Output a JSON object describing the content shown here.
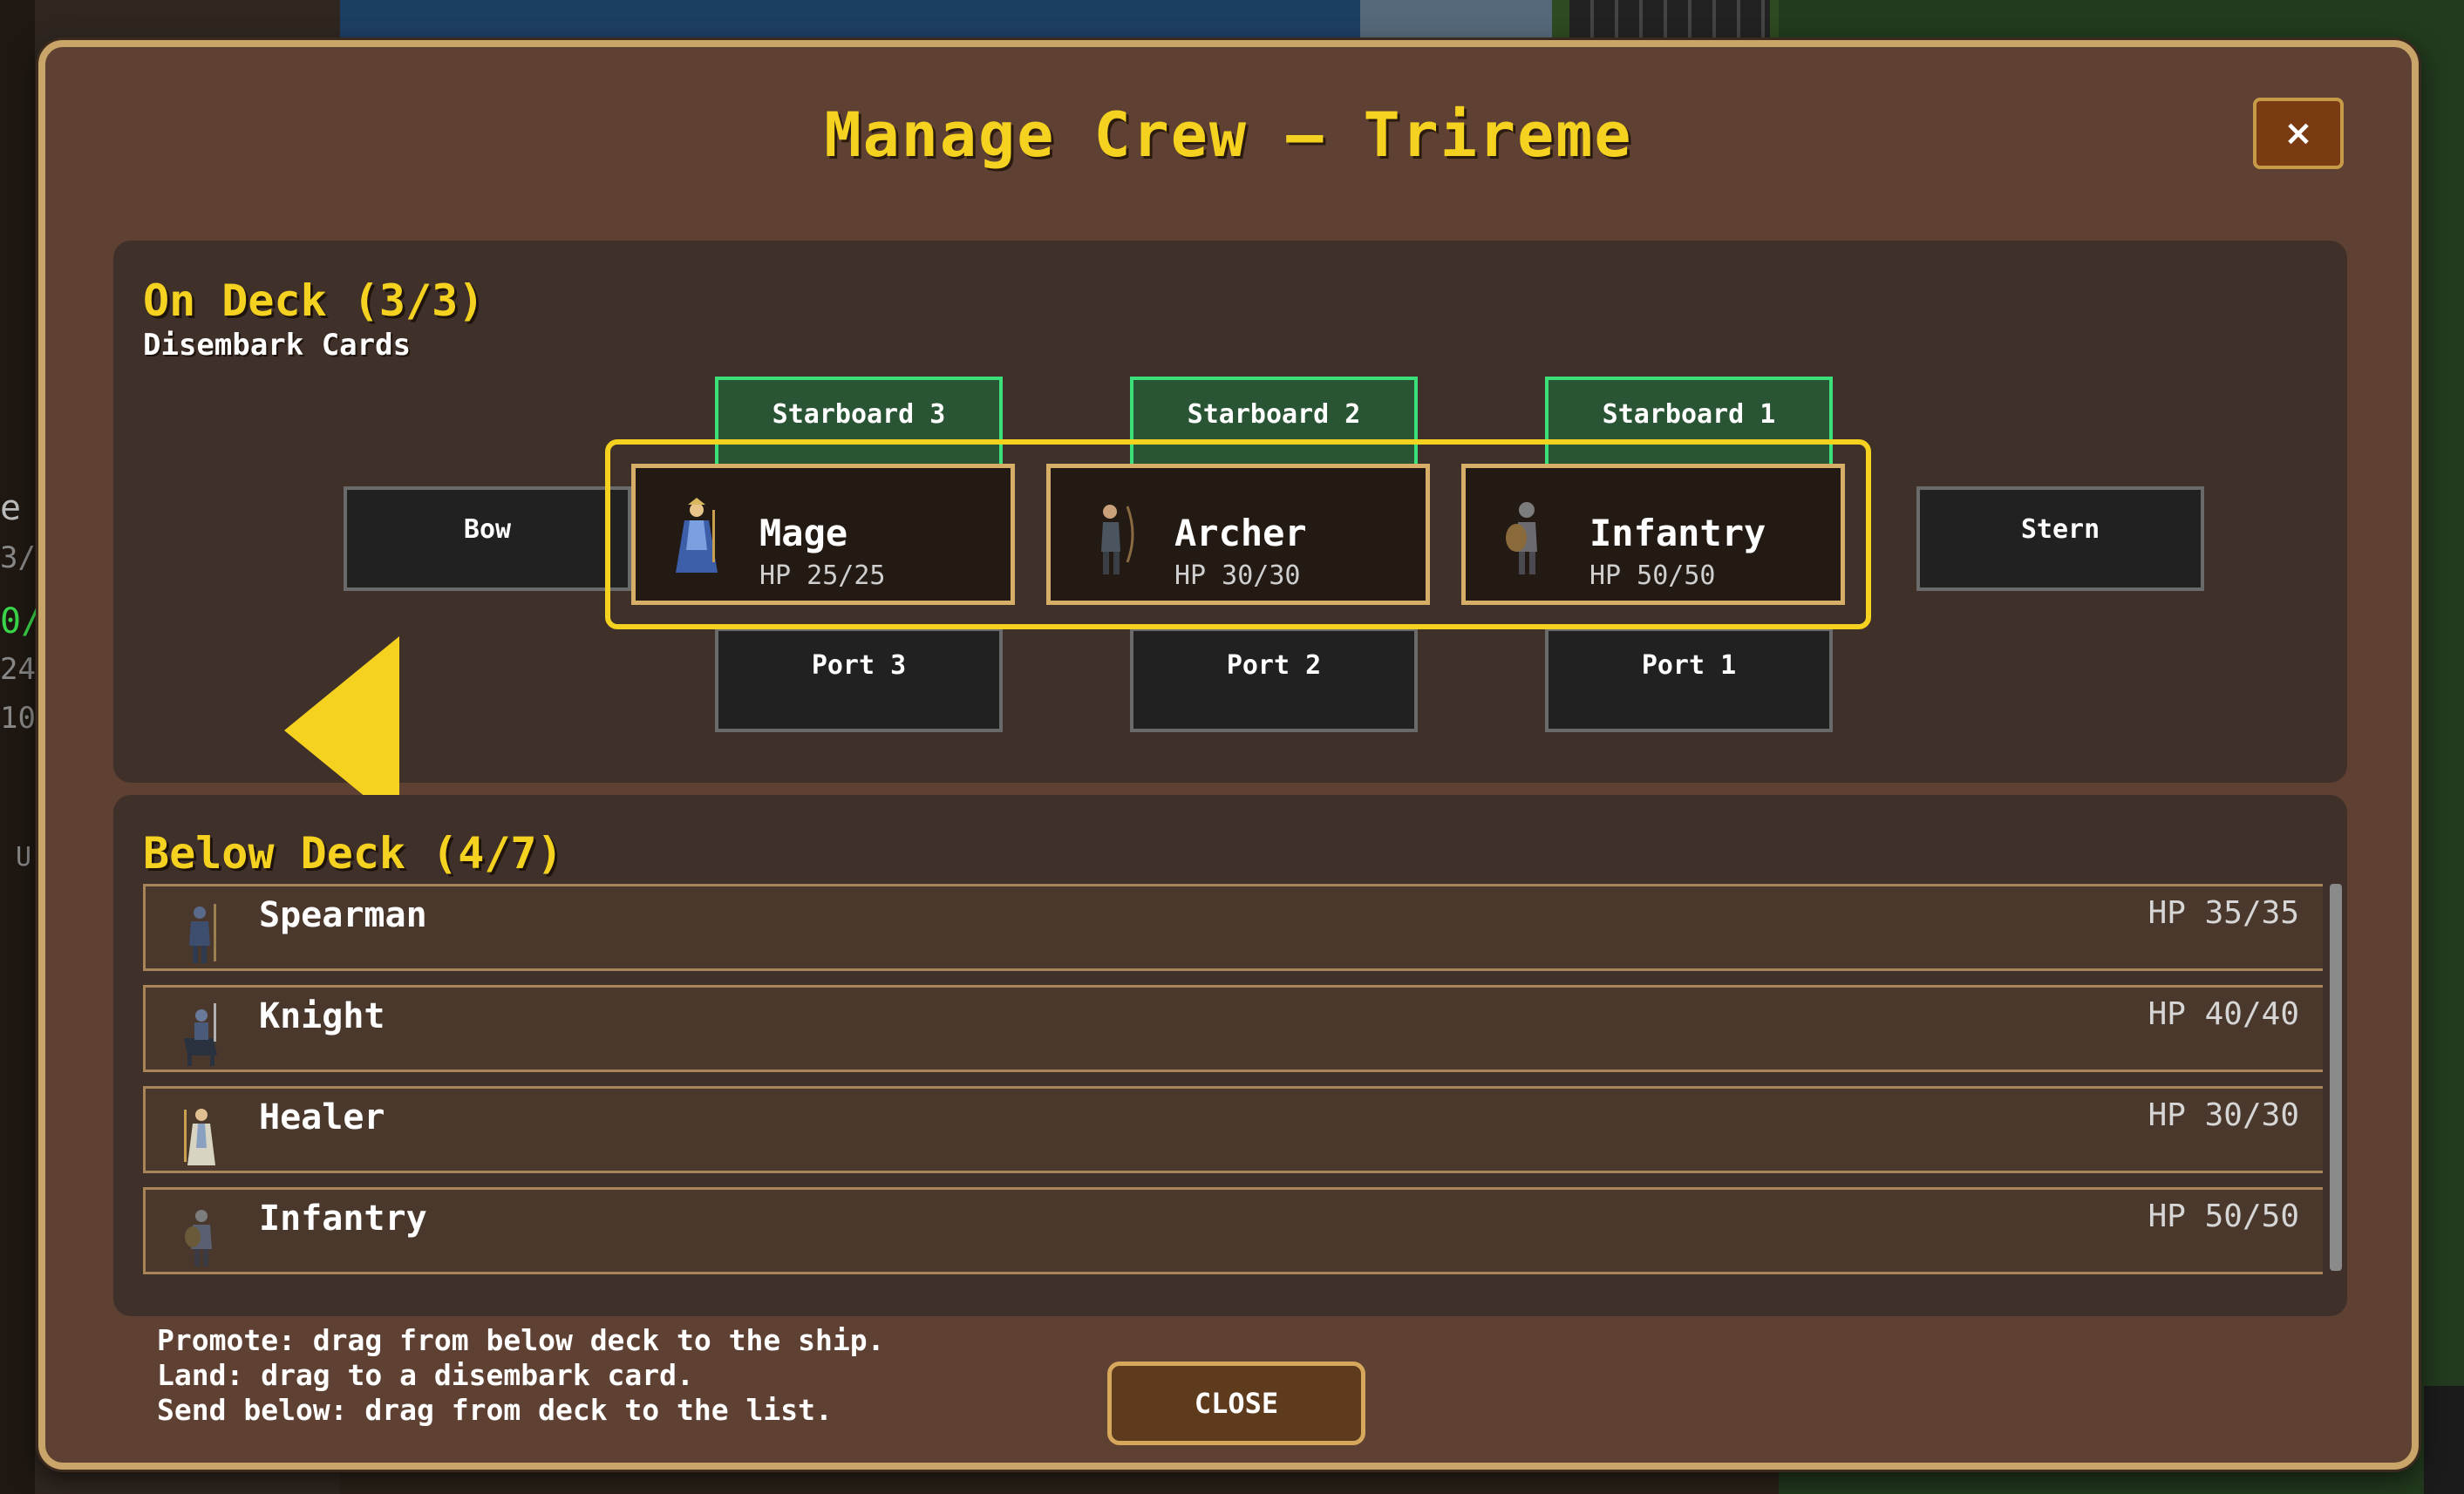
{
  "background": {
    "left_fragments": [
      "e",
      "3/",
      "0/",
      "24",
      "10",
      "U"
    ]
  },
  "modal": {
    "title": "Manage Crew — Trireme",
    "close_icon": "×",
    "close_icon_name": "close-icon"
  },
  "on_deck": {
    "title": "On Deck (3/3)",
    "subtitle": "Disembark Cards",
    "arrow_icon": "left-arrow-icon",
    "starboard": [
      "Starboard 3",
      "Starboard 2",
      "Starboard 1"
    ],
    "port": [
      "Port 3",
      "Port 2",
      "Port 1"
    ],
    "bow": "Bow",
    "stern": "Stern",
    "units": [
      {
        "name": "Mage",
        "hp": "HP 25/25",
        "icon": "mage-icon"
      },
      {
        "name": "Archer",
        "hp": "HP 30/30",
        "icon": "archer-icon"
      },
      {
        "name": "Infantry",
        "hp": "HP 50/50",
        "icon": "infantry-icon"
      }
    ]
  },
  "below_deck": {
    "title": "Below Deck (4/7)",
    "units": [
      {
        "name": "Spearman",
        "hp": "HP 35/35",
        "icon": "spearman-icon"
      },
      {
        "name": "Knight",
        "hp": "HP 40/40",
        "icon": "knight-icon"
      },
      {
        "name": "Healer",
        "hp": "HP 30/30",
        "icon": "healer-icon"
      },
      {
        "name": "Infantry",
        "hp": "HP 50/50",
        "icon": "infantry-icon"
      }
    ]
  },
  "help": {
    "lines": [
      "Promote: drag from below deck to the ship.",
      "Land: drag to a disembark card.",
      "Send below: drag from deck to the list."
    ]
  },
  "buttons": {
    "close_label": "CLOSE"
  },
  "colors": {
    "accent": "#f5d21f",
    "modal_bg": "#5e4132",
    "panel_bg": "#40302a",
    "starboard_green": "#3ce07a"
  }
}
